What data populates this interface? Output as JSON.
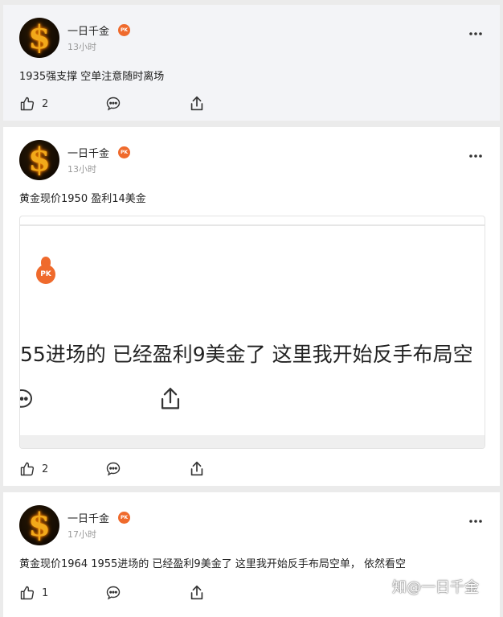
{
  "posts": [
    {
      "author": "一日千金",
      "badge": "PK",
      "time": "13小时",
      "text": "1935强支撑 空单注意随时离场",
      "likes": "2"
    },
    {
      "author": "一日千金",
      "badge": "PK",
      "time": "13小时",
      "text": "黄金现价1950 盈利14美金",
      "likes": "2",
      "embed": {
        "badge": "PK",
        "text": "55进场的 已经盈利9美金了 这里我开始反手布局空",
        "edge_char": ":"
      }
    },
    {
      "author": "一日千金",
      "badge": "PK",
      "time": "17小时",
      "text": "黄金现价1964 1955进场的 已经盈利9美金了 这里我开始反手布局空单， 依然看空",
      "likes": "1"
    }
  ],
  "watermark": "知@一日千金",
  "icons": {
    "like": "thumbs-up-icon",
    "comment": "comment-icon",
    "share": "share-icon",
    "more": "more-icon"
  },
  "colors": {
    "badge": "#ef6a2c",
    "avatar_gold": "#f2a91a"
  }
}
